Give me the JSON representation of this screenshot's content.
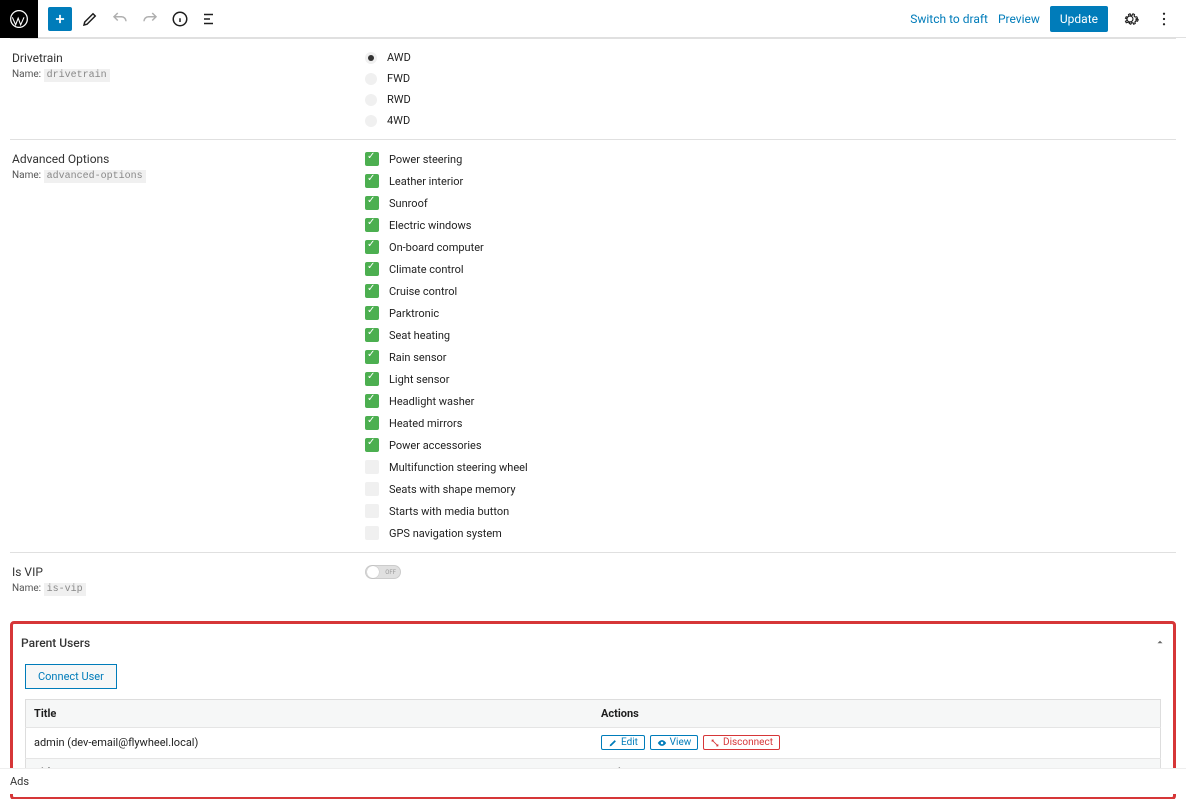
{
  "topbar": {
    "switch_draft": "Switch to draft",
    "preview": "Preview",
    "update": "Update"
  },
  "fields": {
    "drivetrain": {
      "title": "Drivetrain",
      "name_label": "Name:",
      "name_value": "drivetrain",
      "options": [
        {
          "label": "AWD",
          "selected": true
        },
        {
          "label": "FWD",
          "selected": false
        },
        {
          "label": "RWD",
          "selected": false
        },
        {
          "label": "4WD",
          "selected": false
        }
      ]
    },
    "advanced": {
      "title": "Advanced Options",
      "name_label": "Name:",
      "name_value": "advanced-options",
      "options": [
        {
          "label": "Power steering",
          "checked": true
        },
        {
          "label": "Leather interior",
          "checked": true
        },
        {
          "label": "Sunroof",
          "checked": true
        },
        {
          "label": "Electric windows",
          "checked": true
        },
        {
          "label": "On-board computer",
          "checked": true
        },
        {
          "label": "Climate control",
          "checked": true
        },
        {
          "label": "Cruise control",
          "checked": true
        },
        {
          "label": "Parktronic",
          "checked": true
        },
        {
          "label": "Seat heating",
          "checked": true
        },
        {
          "label": "Rain sensor",
          "checked": true
        },
        {
          "label": "Light sensor",
          "checked": true
        },
        {
          "label": "Headlight washer",
          "checked": true
        },
        {
          "label": "Heated mirrors",
          "checked": true
        },
        {
          "label": "Power accessories",
          "checked": true
        },
        {
          "label": "Multifunction steering wheel",
          "checked": false
        },
        {
          "label": "Seats with shape memory",
          "checked": false
        },
        {
          "label": "Starts with media button",
          "checked": false
        },
        {
          "label": "GPS navigation system",
          "checked": false
        }
      ]
    },
    "isvip": {
      "title": "Is VIP",
      "name_label": "Name:",
      "name_value": "is-vip",
      "toggle_label": "OFF",
      "toggle_on": false
    }
  },
  "parent_users": {
    "heading": "Parent Users",
    "connect_label": "Connect User",
    "col_title": "Title",
    "col_actions": "Actions",
    "row_title": "admin (dev-email@flywheel.local)",
    "edit": "Edit",
    "view": "View",
    "disconnect": "Disconnect"
  },
  "footer": {
    "ads": "Ads"
  }
}
